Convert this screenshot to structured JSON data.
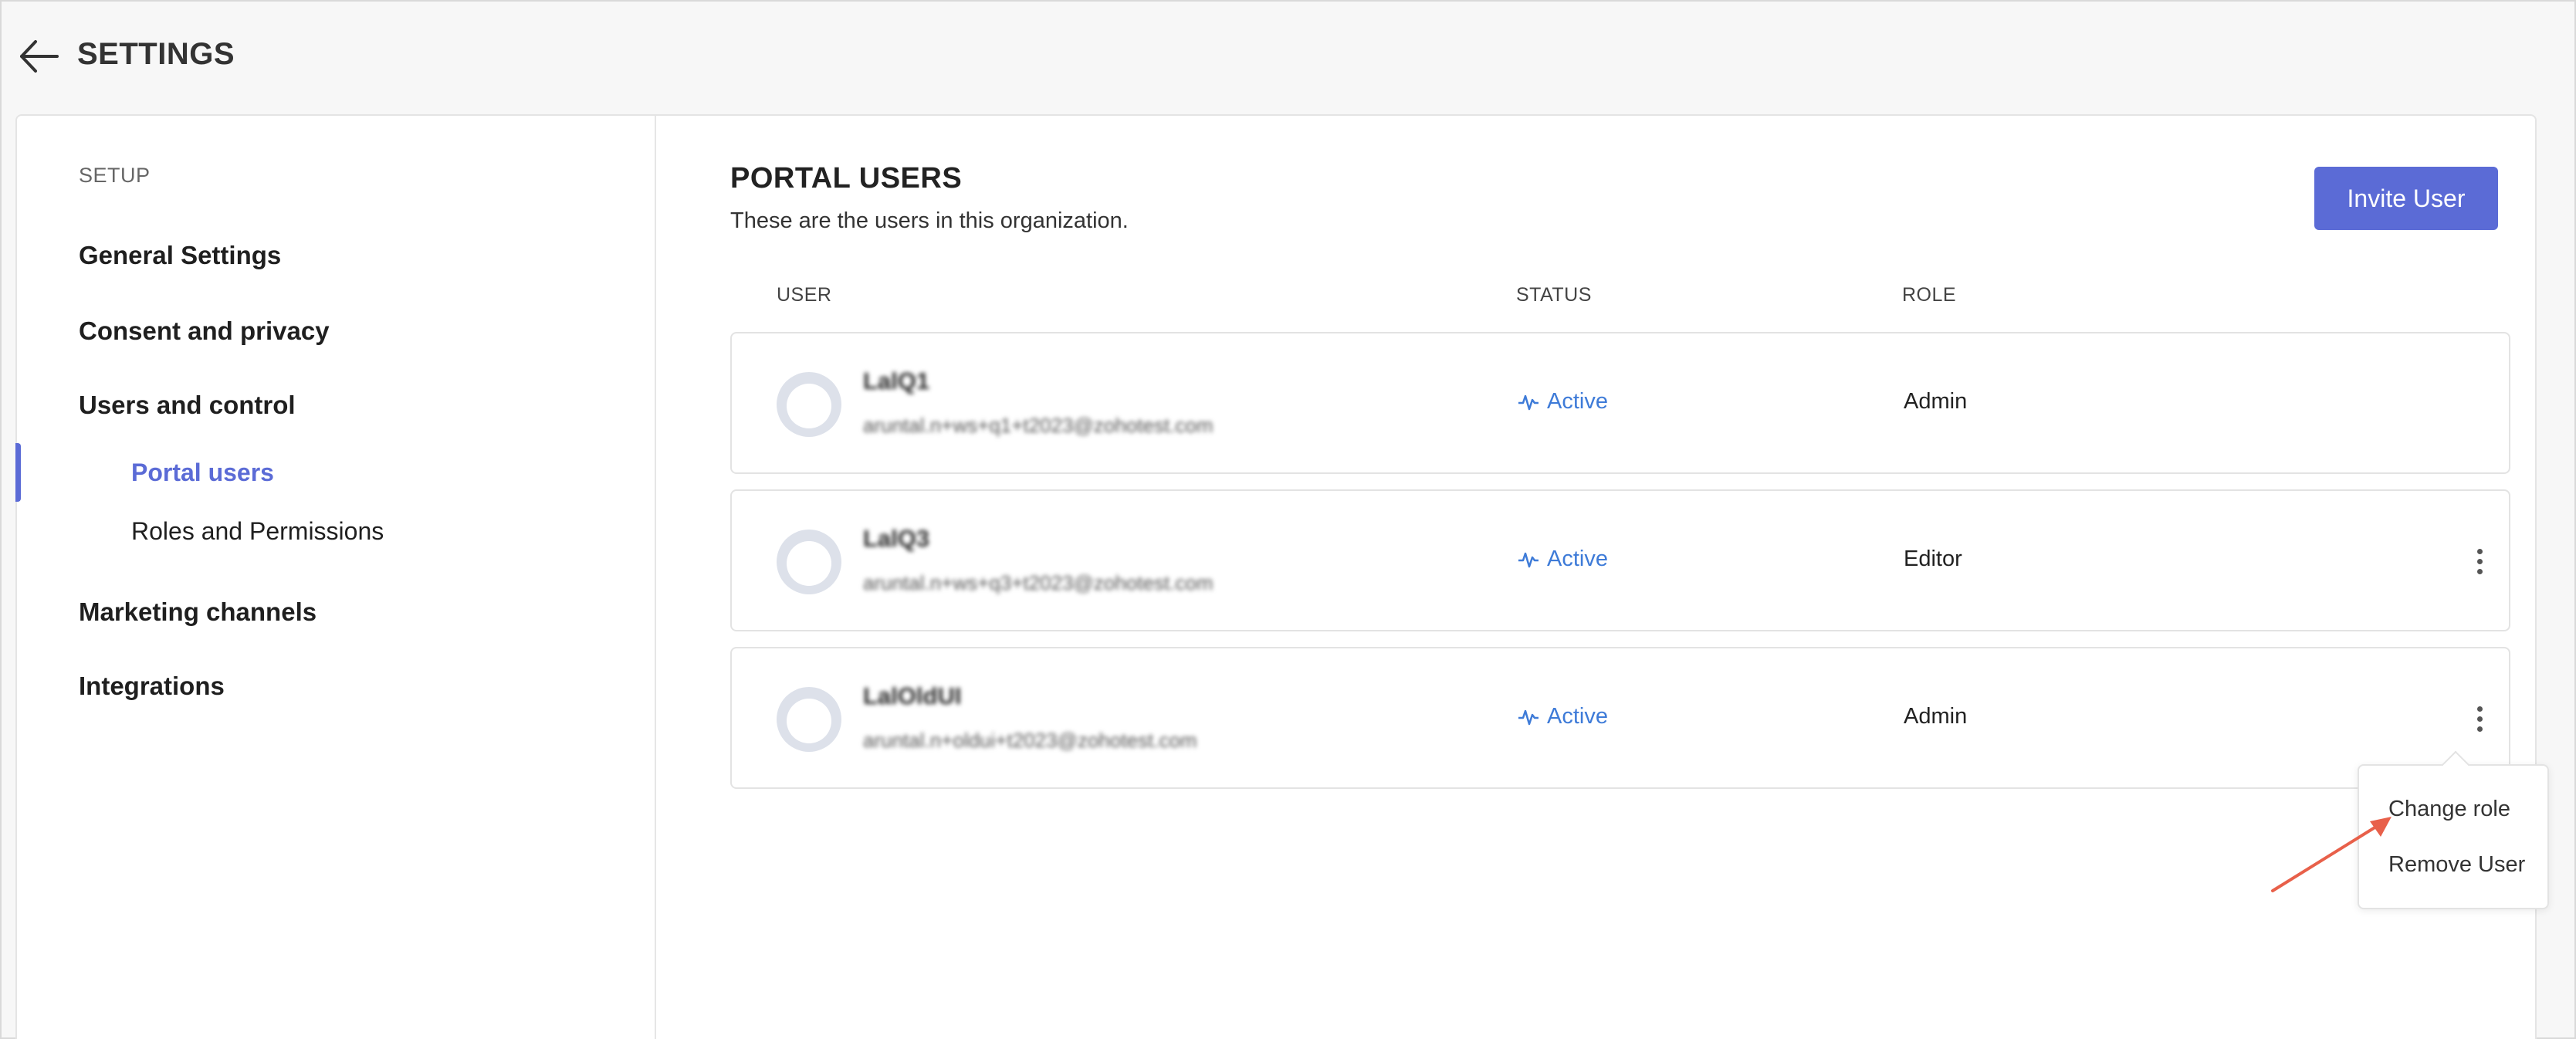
{
  "header": {
    "title": "SETTINGS",
    "back_icon": "arrow-left-icon"
  },
  "sidebar": {
    "section_label": "SETUP",
    "items": [
      {
        "label": "General Settings"
      },
      {
        "label": "Consent and privacy"
      },
      {
        "label": "Users and control",
        "children": [
          {
            "label": "Portal users",
            "active": true
          },
          {
            "label": "Roles and Permissions"
          }
        ]
      },
      {
        "label": "Marketing channels"
      },
      {
        "label": "Integrations"
      }
    ]
  },
  "main": {
    "title": "PORTAL USERS",
    "subtitle": "These are the users in this organization.",
    "invite_button": "Invite User",
    "columns": [
      "USER",
      "STATUS",
      "ROLE"
    ],
    "users": [
      {
        "name": "LalQ1",
        "email": "aruntal.n+ws+q1+t2023@zohotest.com",
        "status": "Active",
        "role": "Admin",
        "has_menu": false
      },
      {
        "name": "LalQ3",
        "email": "aruntal.n+ws+q3+t2023@zohotest.com",
        "status": "Active",
        "role": "Editor",
        "has_menu": true
      },
      {
        "name": "LalOldUI",
        "email": "aruntal.n+oldui+t2023@zohotest.com",
        "status": "Active",
        "role": "Admin",
        "has_menu": true
      }
    ],
    "context_menu": {
      "items": [
        "Change role",
        "Remove User"
      ]
    }
  },
  "colors": {
    "accent": "#5b6bd6",
    "status_active": "#3e7bd8",
    "annotation_arrow": "#e8604a"
  }
}
